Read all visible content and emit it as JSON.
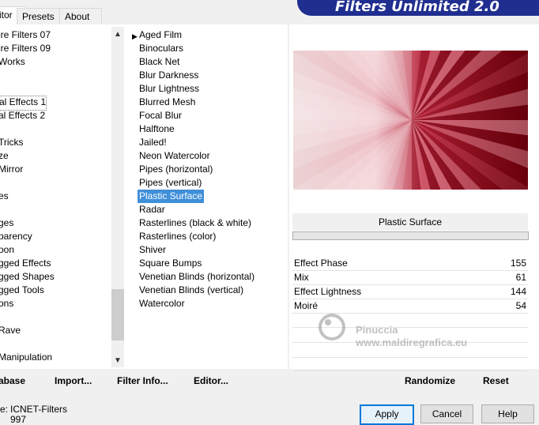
{
  "tabs": [
    {
      "label": "itor"
    },
    {
      "label": "Presets"
    },
    {
      "label": "About"
    }
  ],
  "banner": {
    "title": "Filters Unlimited 2.0"
  },
  "categories": [
    {
      "label": "ire Filters 07"
    },
    {
      "label": "ire Filters 09"
    },
    {
      "label": "Works"
    },
    {
      "label": ""
    },
    {
      "label": ""
    },
    {
      "label": "al Effects 1"
    },
    {
      "label": "al Effects 2"
    },
    {
      "label": ""
    },
    {
      "label": "Tricks"
    },
    {
      "label": "ze"
    },
    {
      "label": "Mirror"
    },
    {
      "label": ""
    },
    {
      "label": "es"
    },
    {
      "label": ""
    },
    {
      "label": "ges"
    },
    {
      "label": "parency"
    },
    {
      "label": "oon"
    },
    {
      "label": "gged Effects"
    },
    {
      "label": "gged Shapes"
    },
    {
      "label": "gged Tools"
    },
    {
      "label": "ons"
    },
    {
      "label": ""
    },
    {
      "label": "Rave"
    },
    {
      "label": ""
    },
    {
      "label": "Manipulation"
    }
  ],
  "filters": [
    {
      "label": "Aged Film"
    },
    {
      "label": "Binoculars"
    },
    {
      "label": "Black Net"
    },
    {
      "label": "Blur Darkness"
    },
    {
      "label": "Blur Lightness"
    },
    {
      "label": "Blurred Mesh"
    },
    {
      "label": "Focal Blur"
    },
    {
      "label": "Halftone"
    },
    {
      "label": "Jailed!"
    },
    {
      "label": "Neon Watercolor"
    },
    {
      "label": "Pipes (horizontal)"
    },
    {
      "label": "Pipes (vertical)"
    },
    {
      "label": "Plastic Surface"
    },
    {
      "label": "Radar"
    },
    {
      "label": "Rasterlines (black & white)"
    },
    {
      "label": "Rasterlines (color)"
    },
    {
      "label": "Shiver"
    },
    {
      "label": "Square Bumps"
    },
    {
      "label": "Venetian Blinds (horizontal)"
    },
    {
      "label": "Venetian Blinds (vertical)"
    },
    {
      "label": "Watercolor"
    }
  ],
  "selected_filter_index": 12,
  "effect": {
    "title": "Plastic Surface",
    "params": [
      {
        "label": "Effect Phase",
        "value": "155"
      },
      {
        "label": "Mix",
        "value": "61"
      },
      {
        "label": "Effect Lightness",
        "value": "144"
      },
      {
        "label": "Moiré",
        "value": "54"
      }
    ]
  },
  "bottom_buttons": {
    "database": "abase",
    "import": "Import...",
    "filter_info": "Filter Info...",
    "editor": "Editor...",
    "randomize": "Randomize",
    "reset": "Reset"
  },
  "status": {
    "line1_label": "e:",
    "line1_value": "ICNET-Filters",
    "line2_value": "997"
  },
  "dialog_buttons": {
    "apply": "Apply",
    "cancel": "Cancel",
    "help": "Help"
  },
  "watermark": {
    "line1": "Pinuccia",
    "line2": "www.maldiregrafica.eu"
  },
  "colors": {
    "accent": "#1f2e8f",
    "selection": "#3f8fd9",
    "preview_red": "#8b0010"
  }
}
